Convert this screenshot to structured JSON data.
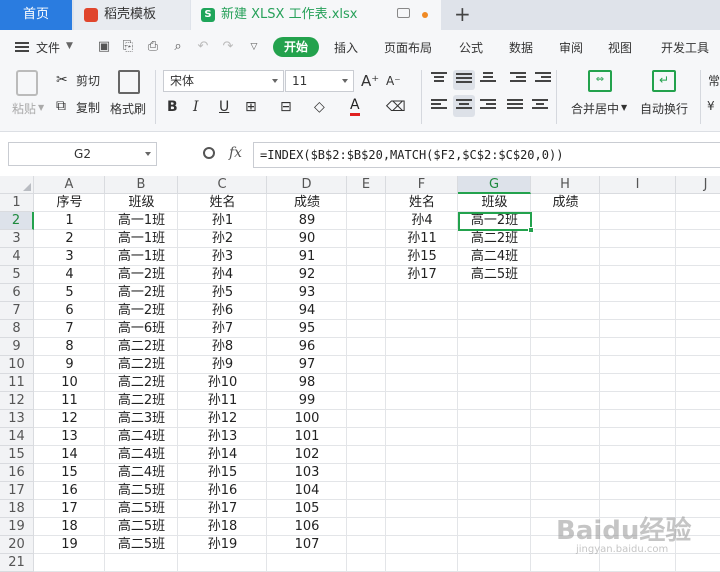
{
  "tabs": {
    "home": "首页",
    "template": "稻壳模板",
    "file": "新建 XLSX 工作表.xlsx",
    "file_icon": "S"
  },
  "menu": {
    "file": "文件",
    "start": "开始",
    "items": [
      "插入",
      "页面布局",
      "公式",
      "数据",
      "审阅",
      "视图",
      "开发工具"
    ]
  },
  "ribbon": {
    "paste": "粘贴",
    "cut": "剪切",
    "copy": "复制",
    "format_painter": "格式刷",
    "font_name": "宋体",
    "font_size": "11",
    "merge_center": "合并居中",
    "wrap_text": "自动换行",
    "partial_right": "常"
  },
  "formula_bar": {
    "cell_ref": "G2",
    "fx": "fx",
    "formula": "=INDEX($B$2:$B$20,MATCH($F2,$C$2:$C$20,0))"
  },
  "sheet": {
    "columns": [
      "A",
      "B",
      "C",
      "D",
      "E",
      "F",
      "G",
      "H",
      "I",
      "J"
    ],
    "rows": [
      "1",
      "2",
      "3",
      "4",
      "5",
      "6",
      "7",
      "8",
      "9",
      "10",
      "11",
      "12",
      "13",
      "14",
      "15",
      "16",
      "17",
      "18",
      "19",
      "20",
      "21"
    ],
    "headers": {
      "A": "序号",
      "B": "班级",
      "C": "姓名",
      "D": "成绩"
    },
    "data": [
      [
        "1",
        "高一1班",
        "孙1",
        "89"
      ],
      [
        "2",
        "高一1班",
        "孙2",
        "90"
      ],
      [
        "3",
        "高一1班",
        "孙3",
        "91"
      ],
      [
        "4",
        "高一2班",
        "孙4",
        "92"
      ],
      [
        "5",
        "高一2班",
        "孙5",
        "93"
      ],
      [
        "6",
        "高一2班",
        "孙6",
        "94"
      ],
      [
        "7",
        "高一6班",
        "孙7",
        "95"
      ],
      [
        "8",
        "高二2班",
        "孙8",
        "96"
      ],
      [
        "9",
        "高二2班",
        "孙9",
        "97"
      ],
      [
        "10",
        "高二2班",
        "孙10",
        "98"
      ],
      [
        "11",
        "高二2班",
        "孙11",
        "99"
      ],
      [
        "12",
        "高二3班",
        "孙12",
        "100"
      ],
      [
        "13",
        "高二4班",
        "孙13",
        "101"
      ],
      [
        "14",
        "高二4班",
        "孙14",
        "102"
      ],
      [
        "15",
        "高二4班",
        "孙15",
        "103"
      ],
      [
        "16",
        "高二5班",
        "孙16",
        "104"
      ],
      [
        "17",
        "高二5班",
        "孙17",
        "105"
      ],
      [
        "18",
        "高二5班",
        "孙18",
        "106"
      ],
      [
        "19",
        "高二5班",
        "孙19",
        "107"
      ]
    ],
    "lookup": {
      "headers": [
        "姓名",
        "班级",
        "成绩"
      ],
      "rows": [
        [
          "孙4",
          "高一2班"
        ],
        [
          "孙11",
          "高二2班"
        ],
        [
          "孙15",
          "高二4班"
        ],
        [
          "孙17",
          "高二5班"
        ]
      ]
    },
    "selected_cell": "G2",
    "accent": "#23a24d"
  },
  "watermark": {
    "brand": "Baidu经验",
    "url": "jingyan.baidu.com"
  }
}
